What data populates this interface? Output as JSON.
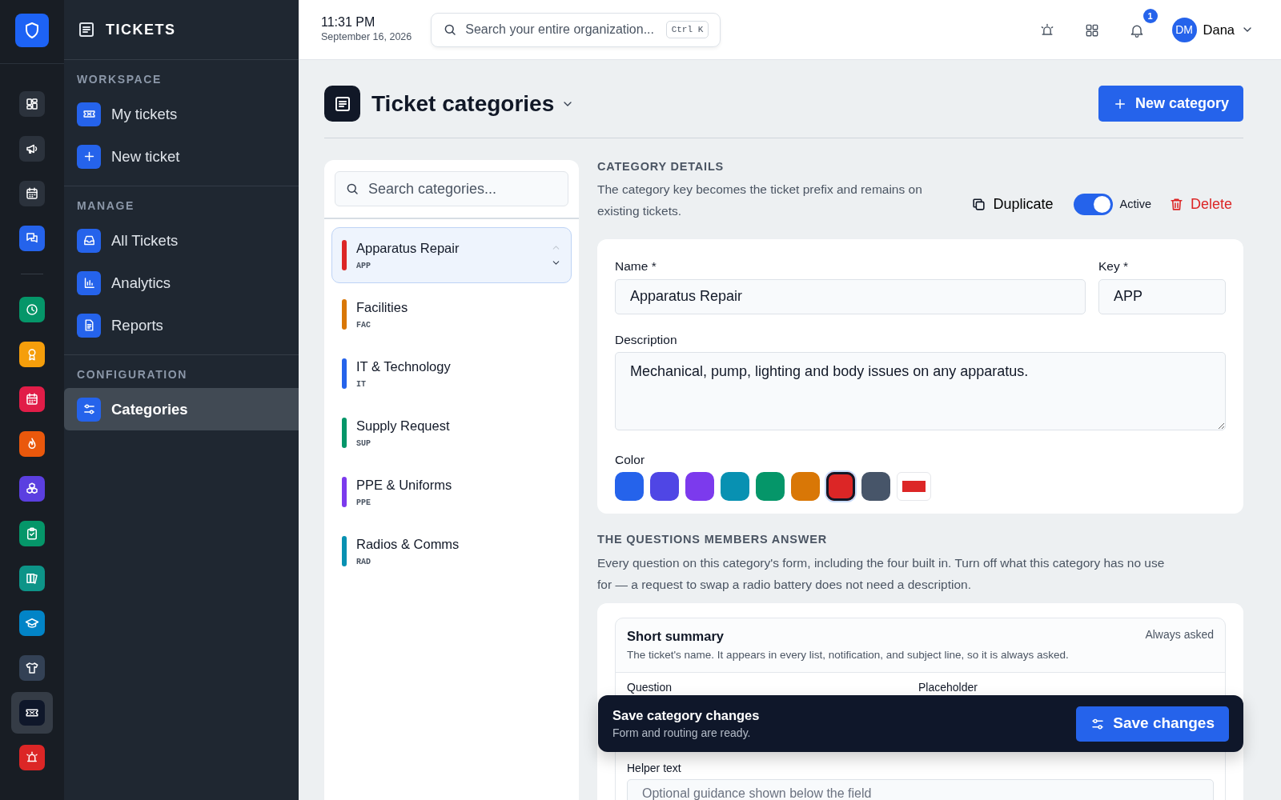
{
  "rail": {
    "items": [
      {
        "color": "#2b323c",
        "selected": false
      },
      {
        "color": "#2b323c",
        "selected": false
      },
      {
        "color": "#2b323c",
        "selected": false
      },
      {
        "color": "#2563eb",
        "selected": false
      },
      {
        "color": "#059669",
        "selected": false
      },
      {
        "color": "#f59e0b",
        "selected": false
      },
      {
        "color": "#e11d48",
        "selected": false
      },
      {
        "color": "#ea580c",
        "selected": false
      },
      {
        "color": "#5b3fe0",
        "selected": false
      },
      {
        "color": "#059669",
        "selected": false
      },
      {
        "color": "#0d9488",
        "selected": false
      },
      {
        "color": "#0284c7",
        "selected": false
      },
      {
        "color": "#334155",
        "selected": false
      },
      {
        "color": "#0f172a",
        "selected": true
      },
      {
        "color": "#dc2626",
        "selected": false
      }
    ]
  },
  "sidebar": {
    "title": "TICKETS",
    "sections": [
      {
        "heading": "WORKSPACE",
        "items": [
          {
            "label": "My tickets",
            "selected": false
          },
          {
            "label": "New ticket",
            "selected": false
          }
        ]
      },
      {
        "heading": "MANAGE",
        "items": [
          {
            "label": "All Tickets",
            "selected": false
          },
          {
            "label": "Analytics",
            "selected": false
          },
          {
            "label": "Reports",
            "selected": false
          }
        ]
      },
      {
        "heading": "CONFIGURATION",
        "items": [
          {
            "label": "Categories",
            "selected": true
          }
        ]
      }
    ]
  },
  "topbar": {
    "time": "11:31 PM",
    "date": "September 16, 2026",
    "search_placeholder": "Search your entire organization...",
    "shortcut": "Ctrl K",
    "notification_count": "1",
    "avatar": "DM",
    "user": "Dana"
  },
  "page": {
    "title": "Ticket categories",
    "new_button": "New category"
  },
  "categories": {
    "search_placeholder": "Search categories...",
    "items": [
      {
        "name": "Apparatus Repair",
        "key": "APP",
        "color": "#dc2626",
        "selected": true
      },
      {
        "name": "Facilities",
        "key": "FAC",
        "color": "#d97706",
        "selected": false
      },
      {
        "name": "IT & Technology",
        "key": "IT",
        "color": "#2563eb",
        "selected": false
      },
      {
        "name": "Supply Request",
        "key": "SUP",
        "color": "#059669",
        "selected": false
      },
      {
        "name": "PPE & Uniforms",
        "key": "PPE",
        "color": "#7c3aed",
        "selected": false
      },
      {
        "name": "Radios & Comms",
        "key": "RAD",
        "color": "#0891b2",
        "selected": false
      }
    ]
  },
  "details": {
    "heading": "CATEGORY DETAILS",
    "description": "The category key becomes the ticket prefix and remains on existing tickets.",
    "duplicate": "Duplicate",
    "active": {
      "label": "Active",
      "on": true
    },
    "delete": "Delete",
    "name_label": "Name *",
    "name_value": "Apparatus Repair",
    "key_label": "Key *",
    "key_value": "APP",
    "description_label": "Description",
    "description_value": "Mechanical, pump, lighting and body issues on any apparatus.",
    "color_label": "Color",
    "swatches": [
      {
        "color": "#2563eb",
        "selected": false
      },
      {
        "color": "#4f46e5",
        "selected": false
      },
      {
        "color": "#7c3aed",
        "selected": false
      },
      {
        "color": "#0891b2",
        "selected": false
      },
      {
        "color": "#059669",
        "selected": false
      },
      {
        "color": "#d97706",
        "selected": false
      },
      {
        "color": "#dc2626",
        "selected": true
      },
      {
        "color": "#475569",
        "selected": false
      }
    ],
    "custom_swatch": {
      "color": "#dc2626"
    }
  },
  "questions": {
    "heading": "THE QUESTIONS MEMBERS ANSWER",
    "description": "Every question on this category's form, including the four built in. Turn off what this category has no use for — a request to swap a radio battery does not need a description.",
    "card": {
      "title": "Short summary",
      "badge": "Always asked",
      "description": "The ticket's name. It appears in every list, notification, and subject line, so it is always asked.",
      "question_label": "Question",
      "placeholder_label": "Placeholder",
      "helper_label": "Helper text",
      "helper_placeholder": "Optional guidance shown below the field"
    }
  },
  "save_bar": {
    "title": "Save category changes",
    "subtitle": "Form and routing are ready.",
    "button": "Save changes"
  }
}
